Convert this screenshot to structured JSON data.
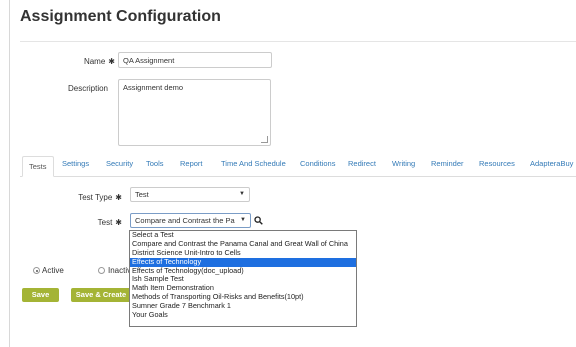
{
  "page": {
    "title": "Assignment Configuration"
  },
  "form": {
    "name_label": "Name",
    "name_value": "QA Assignment",
    "description_label": "Description",
    "description_value": "Assignment demo",
    "required_mark": "✱"
  },
  "tabs": [
    {
      "label": "Tests",
      "active": true
    },
    {
      "label": "Settings"
    },
    {
      "label": "Security"
    },
    {
      "label": "Tools"
    },
    {
      "label": "Report"
    },
    {
      "label": "Time And Schedule"
    },
    {
      "label": "Conditions"
    },
    {
      "label": "Redirect"
    },
    {
      "label": "Writing"
    },
    {
      "label": "Reminder"
    },
    {
      "label": "Resources"
    },
    {
      "label": "AdapteraBuy"
    }
  ],
  "tests_tab": {
    "test_type_label": "Test Type",
    "test_type_value": "Test",
    "test_label": "Test",
    "test_value": "Compare and Contrast the Pa",
    "dropdown_options": [
      "Select a Test",
      "Compare and Contrast the Panama Canal and Great Wall of China",
      "District Science Unit-Intro to Cells",
      "Effects of Technology",
      "Effects of Technology(doc_upload)",
      "Ish Sample Test",
      "Math Item Demonstration",
      "Methods of Transporting Oil-Risks and Benefits(10pt)",
      "Sumner Grade 7 Benchmark 1",
      "Your Goals"
    ],
    "highlighted_option": "Effects of Technology"
  },
  "status": {
    "active_label": "Active",
    "inactive_label": "Inactive",
    "selected": "Active"
  },
  "buttons": {
    "save": "Save",
    "save_create": "Save & Create"
  },
  "colors": {
    "button": "#a4b435",
    "link": "#337ab7",
    "highlight": "#1e6fe0"
  }
}
